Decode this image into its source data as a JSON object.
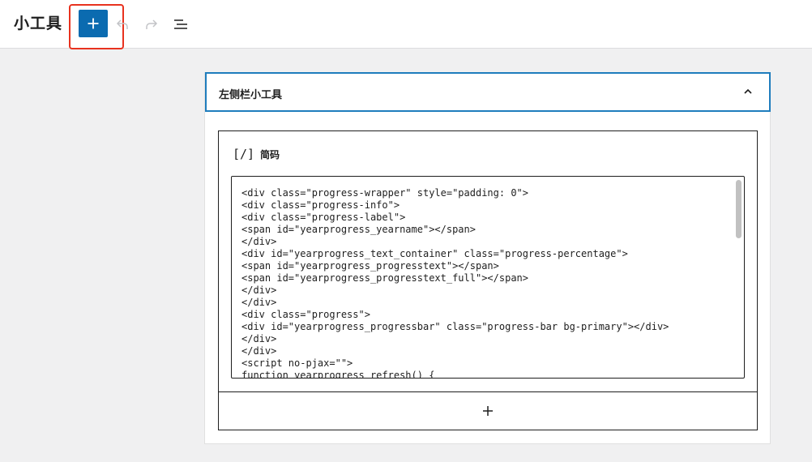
{
  "header": {
    "title": "小工具",
    "add_button_icon": "plus-icon",
    "undo_icon": "undo-icon",
    "redo_icon": "redo-icon",
    "list_view_icon": "list-view-icon"
  },
  "colors": {
    "accent": "#0b6bb0",
    "highlight": "#e8321f",
    "focus_border": "#1f7dbd"
  },
  "widget_area": {
    "title": "左侧栏小工具",
    "toggle_icon": "chevron-up-icon"
  },
  "shortcode_block": {
    "icon_text": "[/]",
    "label": "简码",
    "code_lines": [
      "<div class=\"progress-wrapper\" style=\"padding: 0\">",
      "<div class=\"progress-info\">",
      "<div class=\"progress-label\">",
      "<span id=\"yearprogress_yearname\"></span>",
      "</div>",
      "<div id=\"yearprogress_text_container\" class=\"progress-percentage\">",
      "<span id=\"yearprogress_progresstext\"></span>",
      "<span id=\"yearprogress_progresstext_full\"></span>",
      "</div>",
      "</div>",
      "<div class=\"progress\">",
      "<div id=\"yearprogress_progressbar\" class=\"progress-bar bg-primary\"></div>",
      "</div>",
      "</div>",
      "<script no-pjax=\"\">",
      "function yearprogress_refresh() {"
    ]
  },
  "appender": {
    "icon": "plus-icon"
  }
}
